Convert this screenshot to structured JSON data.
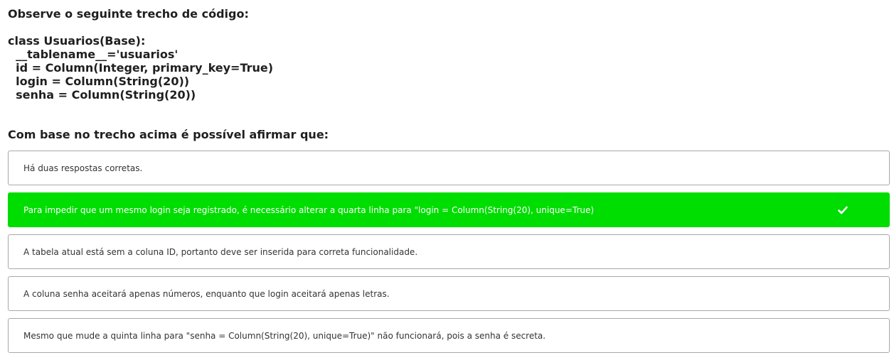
{
  "question": {
    "intro": "Observe o seguinte trecho de código:",
    "code_lines": [
      "class Usuarios(Base):",
      "  __tablename__='usuarios'",
      "  id = Column(Integer, primary_key=True)",
      "  login = Column(String(20))",
      "  senha = Column(String(20))"
    ],
    "prompt": "Com base no trecho acima é possível afirmar que:"
  },
  "options": [
    {
      "label": "Há duas respostas corretas.",
      "selected": false
    },
    {
      "label": "Para impedir que um mesmo login seja registrado, é necessário alterar a quarta linha para \"login = Column(String(20), unique=True)",
      "selected": true
    },
    {
      "label": "A tabela atual está sem a coluna ID, portanto deve ser inserida para correta funcionalidade.",
      "selected": false
    },
    {
      "label": "A coluna senha aceitará apenas números, enquanto que login aceitará apenas letras.",
      "selected": false
    },
    {
      "label": "Mesmo que mude a quinta linha para \"senha = Column(String(20), unique=True)\" não funcionará, pois a senha é secreta.",
      "selected": false
    }
  ],
  "colors": {
    "selected_background": "#00dd00",
    "border": "#a8a8a8"
  },
  "icons": {
    "selected_option": "check-icon"
  }
}
